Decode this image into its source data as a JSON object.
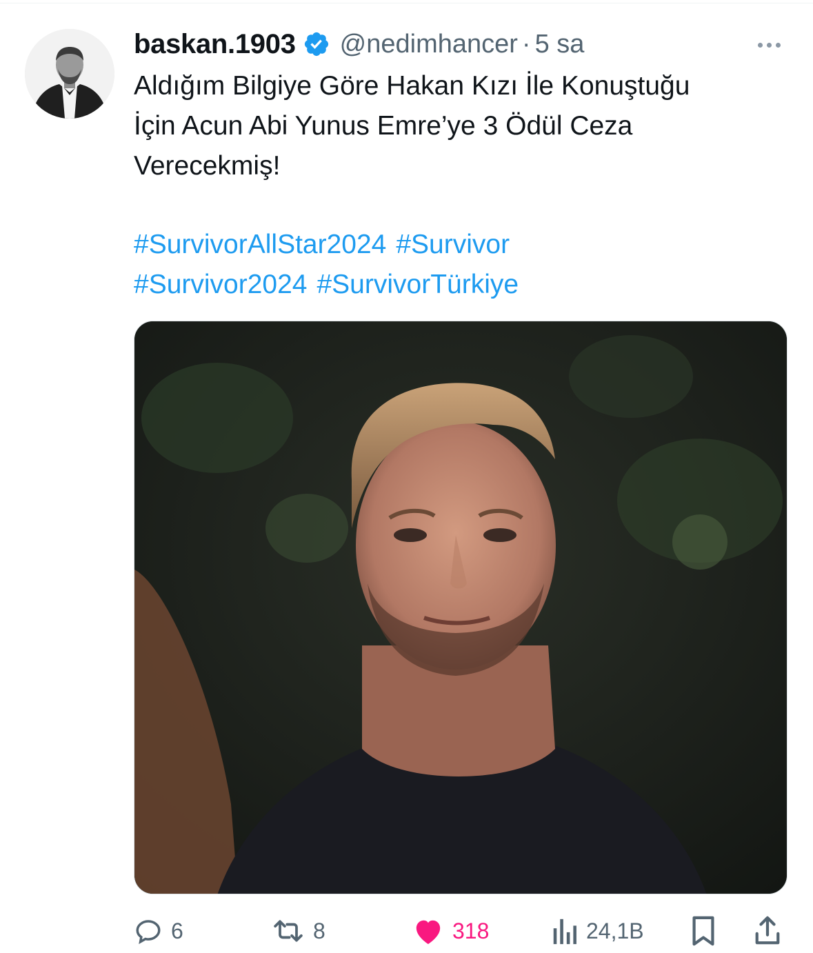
{
  "tweet": {
    "display_name": "baskan.1903",
    "handle": "@nedimhancer",
    "separator": "·",
    "time": "5 sa",
    "text_lines": [
      "Aldığım Bilgiye Göre Hakan Kızı İle Konuştuğu",
      "İçin Acun Abi Yunus Emre’ye 3 Ödül Ceza",
      "Verecekmiş!"
    ],
    "hashtags": [
      "#SurvivorAllStar2024",
      "#Survivor",
      "#Survivor2024",
      "#SurvivorTürkiye"
    ]
  },
  "actions": {
    "replies": "6",
    "retweets": "8",
    "likes": "318",
    "views": "24,1B"
  },
  "icons": {
    "verified": "verified-badge-icon",
    "more": "more-horizontal-icon",
    "reply": "reply-icon",
    "retweet": "retweet-icon",
    "like": "heart-icon",
    "views": "views-icon",
    "bookmark": "bookmark-icon",
    "share": "share-icon"
  },
  "colors": {
    "text": "#0f1419",
    "secondary": "#536471",
    "hashtag": "#1d9bf0",
    "like": "#f91880",
    "verified": "#1d9bf0"
  }
}
